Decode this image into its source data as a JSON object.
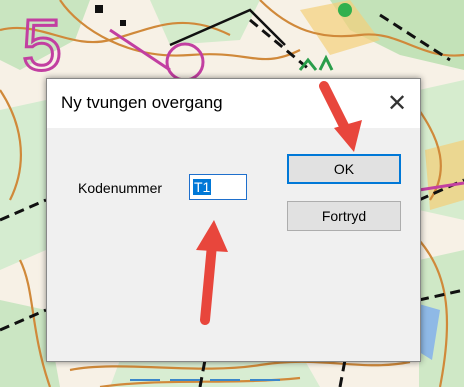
{
  "dialog": {
    "title": "Ny tvungen overgang",
    "close_label": "✕",
    "field_label": "Kodenummer",
    "field_value": "T1",
    "ok_label": "OK",
    "cancel_label": "Fortryd"
  },
  "map": {
    "course_number": "5"
  },
  "colors": {
    "dialog_bg": "#f0f0f0",
    "titlebar_bg": "#ffffff",
    "selection": "#0078d7",
    "arrow": "#e8463c",
    "map_purple": "#c23fa1",
    "map_contour": "#d0893a",
    "map_green": "#bfe0b4"
  }
}
